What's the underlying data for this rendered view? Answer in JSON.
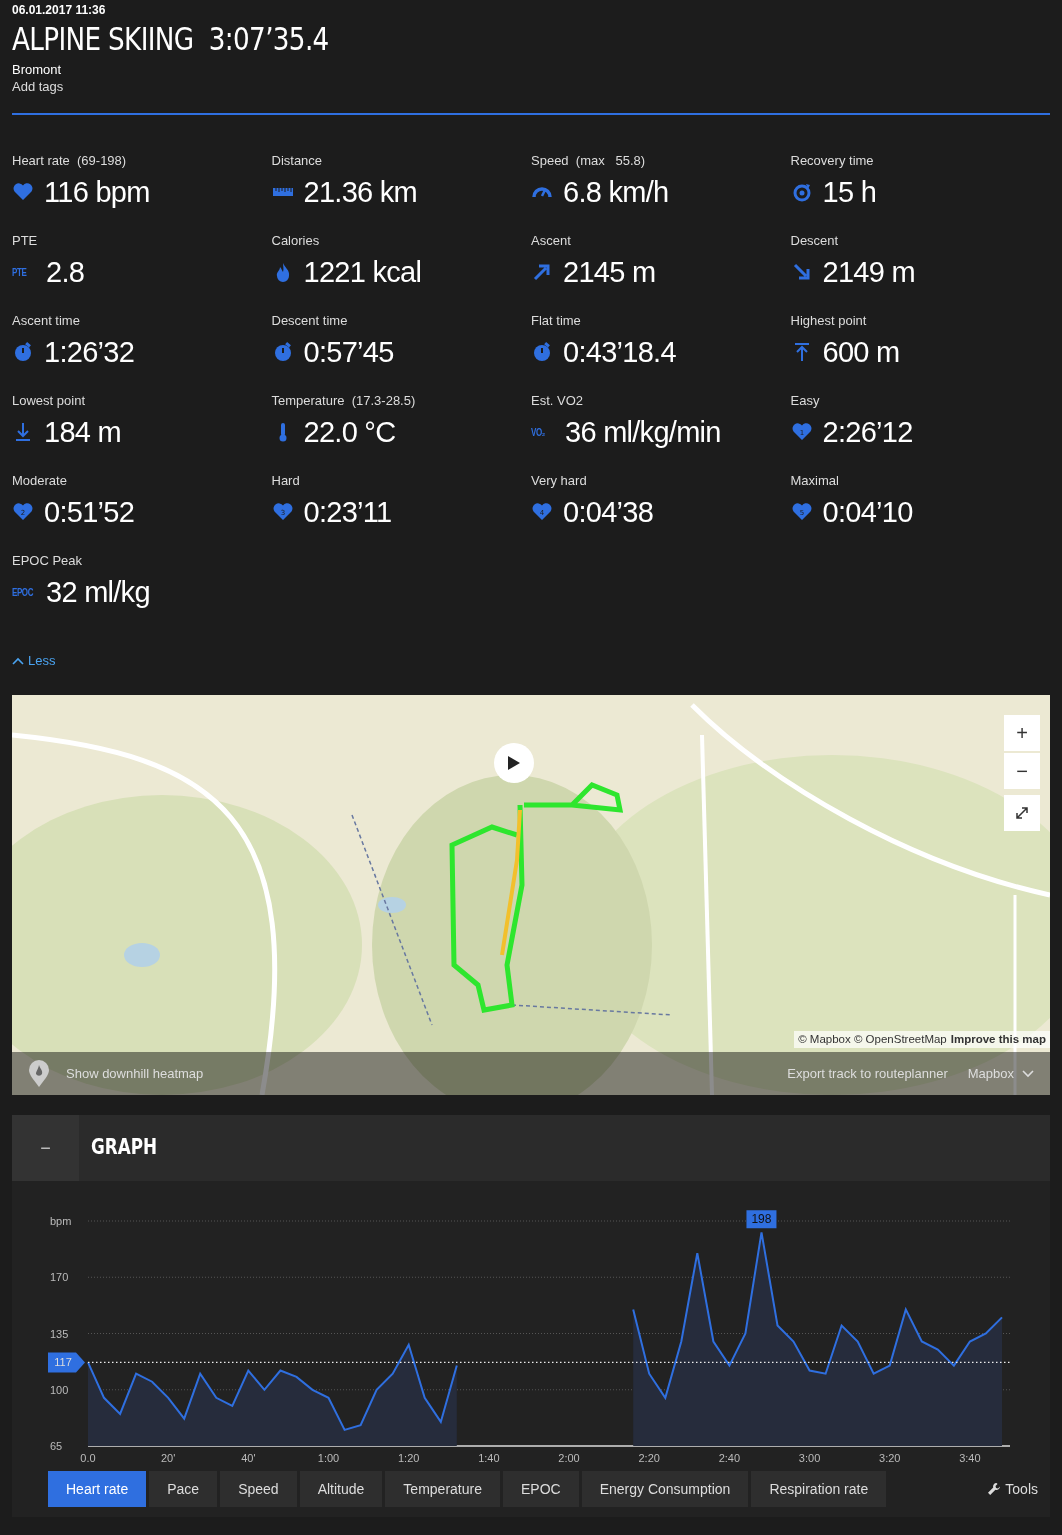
{
  "header": {
    "date": "06.01.2017 11:36",
    "sport": "ALPINE SKIING",
    "duration": "3:07’35.4",
    "location": "Bromont",
    "tags_link": "Add tags"
  },
  "stats": [
    {
      "label": "Heart rate  (69-198)",
      "value": "116 bpm",
      "kind": "heart"
    },
    {
      "label": "Distance",
      "value": "21.36 km",
      "kind": "ruler"
    },
    {
      "label": "Speed  (max   55.8)",
      "value": "6.8 km/h",
      "kind": "gauge"
    },
    {
      "label": "Recovery time",
      "value": "15 h",
      "kind": "recovery"
    },
    {
      "label": "PTE",
      "value": "2.8",
      "kind": "text",
      "icon_text": "PTE"
    },
    {
      "label": "Calories",
      "value": "1221 kcal",
      "kind": "flame"
    },
    {
      "label": "Ascent",
      "value": "2145 m",
      "kind": "up"
    },
    {
      "label": "Descent",
      "value": "2149 m",
      "kind": "down"
    },
    {
      "label": "Ascent time",
      "value": "1:26’32",
      "kind": "clock"
    },
    {
      "label": "Descent time",
      "value": "0:57’45",
      "kind": "clock"
    },
    {
      "label": "Flat time",
      "value": "0:43’18.4",
      "kind": "clock"
    },
    {
      "label": "Highest point",
      "value": "600 m",
      "kind": "top"
    },
    {
      "label": "Lowest point",
      "value": "184 m",
      "kind": "bottom"
    },
    {
      "label": "Temperature  (17.3-28.5)",
      "value": "22.0 °C",
      "kind": "thermometer"
    },
    {
      "label": "Est. VO2",
      "value": "36 ml/kg/min",
      "kind": "text",
      "icon_text": "VO₂"
    },
    {
      "label": "Easy",
      "value": "2:26’12",
      "kind": "zone",
      "zone": "1"
    },
    {
      "label": "Moderate",
      "value": "0:51’52",
      "kind": "zone",
      "zone": "2"
    },
    {
      "label": "Hard",
      "value": "0:23’11",
      "kind": "zone",
      "zone": "3"
    },
    {
      "label": "Very hard",
      "value": "0:04’38",
      "kind": "zone",
      "zone": "4"
    },
    {
      "label": "Maximal",
      "value": "0:04’10",
      "kind": "zone",
      "zone": "5"
    },
    {
      "label": "EPOC Peak",
      "value": "32 ml/kg",
      "kind": "text",
      "icon_text": "EPOC"
    }
  ],
  "less_link": "Less",
  "map": {
    "kind": "picture",
    "zoom_in": "+",
    "zoom_out": "−",
    "attribution": "© Mapbox © OpenStreetMap",
    "improve_link": "Improve this map",
    "heatmap_label": "Show downhill heatmap",
    "export_label": "Export track to routeplanner",
    "style_label": "Mapbox"
  },
  "graph": {
    "collapse": "−",
    "title": "GRAPH",
    "chart_data": {
      "type": "area",
      "ylabel": "bpm",
      "ylim": [
        65,
        205
      ],
      "yticks": [
        65,
        100,
        135,
        170
      ],
      "xlim": [
        0,
        230
      ],
      "grid": true,
      "xticks": [
        {
          "value": 0,
          "label": "0.0"
        },
        {
          "value": 20,
          "label": "20'"
        },
        {
          "value": 40,
          "label": "40'"
        },
        {
          "value": 60,
          "label": "1:00"
        },
        {
          "value": 80,
          "label": "1:20"
        },
        {
          "value": 100,
          "label": "1:40"
        },
        {
          "value": 120,
          "label": "2:00"
        },
        {
          "value": 140,
          "label": "2:20"
        },
        {
          "value": 160,
          "label": "2:40"
        },
        {
          "value": 180,
          "label": "3:00"
        },
        {
          "value": 200,
          "label": "3:20"
        },
        {
          "value": 220,
          "label": "3:40"
        }
      ],
      "x": [
        0,
        4,
        8,
        12,
        16,
        20,
        24,
        28,
        32,
        36,
        40,
        44,
        48,
        52,
        56,
        60,
        64,
        68,
        72,
        76,
        80,
        84,
        88,
        92,
        96,
        100,
        104,
        108,
        112,
        116,
        120,
        124,
        128,
        132,
        136,
        140,
        144,
        148,
        152,
        156,
        160,
        164,
        168,
        172,
        176,
        180,
        184,
        188,
        192,
        196,
        200,
        204,
        208,
        212,
        216,
        220,
        224,
        228
      ],
      "series": [
        {
          "color": "#2f6fe0",
          "values": [
            117,
            95,
            85,
            110,
            105,
            95,
            82,
            110,
            95,
            90,
            112,
            100,
            112,
            108,
            100,
            95,
            75,
            78,
            100,
            110,
            128,
            95,
            80,
            115,
            null,
            null,
            null,
            null,
            null,
            null,
            null,
            null,
            null,
            null,
            150,
            110,
            95,
            130,
            185,
            130,
            115,
            135,
            198,
            140,
            130,
            112,
            110,
            140,
            130,
            110,
            115,
            150,
            130,
            125,
            115,
            130,
            135,
            145
          ]
        }
      ],
      "ref_lines": [
        {
          "axis": "y",
          "value": 117,
          "label": "117"
        }
      ],
      "annotations": [
        "198"
      ]
    },
    "tabs": [
      {
        "label": "Heart rate",
        "selected": true
      },
      {
        "label": "Pace",
        "selected": false
      },
      {
        "label": "Speed",
        "selected": false
      },
      {
        "label": "Altitude",
        "selected": false
      },
      {
        "label": "Temperature",
        "selected": false
      },
      {
        "label": "EPOC",
        "selected": false
      },
      {
        "label": "Energy Consumption",
        "selected": false
      },
      {
        "label": "Respiration rate",
        "selected": false
      }
    ],
    "tools_link": "Tools"
  }
}
